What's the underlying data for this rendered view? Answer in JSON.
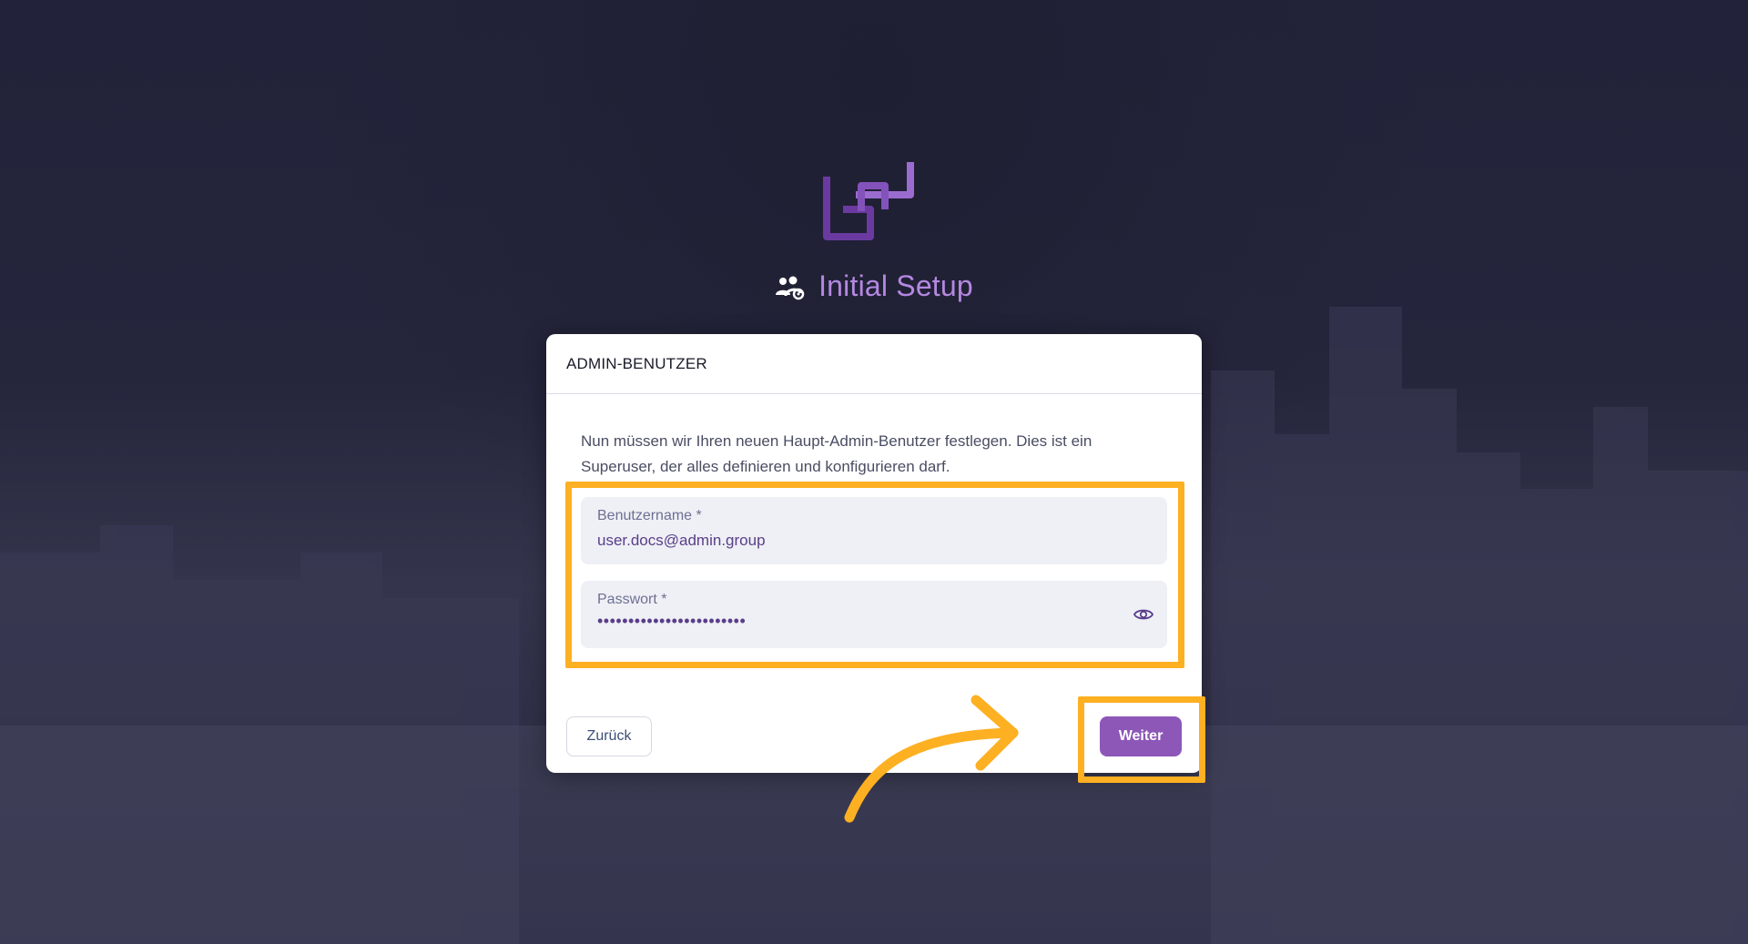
{
  "header": {
    "title": "Initial Setup",
    "title_icon": "users-cog-icon",
    "logo": "tsg-logo"
  },
  "card": {
    "heading": "ADMIN-BENUTZER",
    "description": "Nun müssen wir Ihren neuen Haupt-Admin-Benutzer festlegen. Dies ist ein Superuser, der alles definieren und konfigurieren darf.",
    "username": {
      "label": "Benutzername *",
      "value": "user.docs@admin.group"
    },
    "password": {
      "label": "Passwort *",
      "value": "••••••••••••••••••••••••",
      "toggle_icon": "eye-icon"
    },
    "back_label": "Zurück",
    "next_label": "Weiter"
  },
  "colors": {
    "accent": "#8d57b8",
    "title": "#b488e0",
    "highlight": "#fdb022",
    "background": "#24243a"
  }
}
